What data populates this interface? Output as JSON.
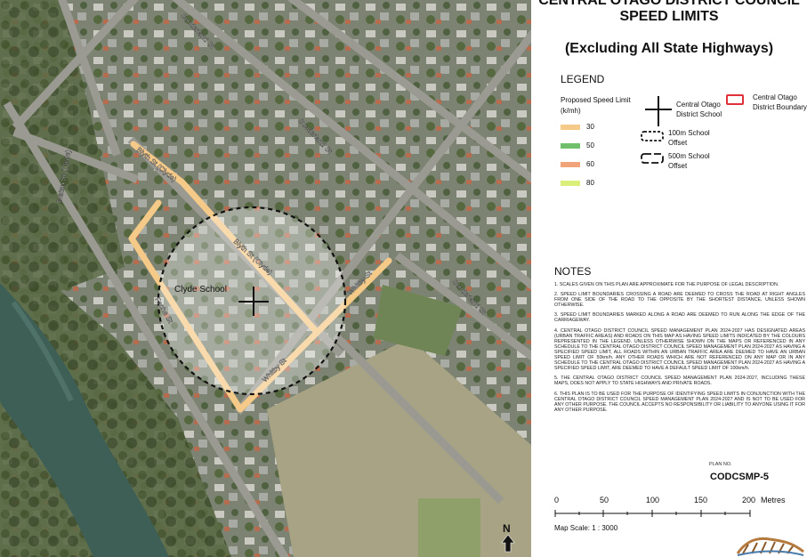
{
  "title_line1": "CENTRAL OTAGO DISTRICT COUNCIL",
  "title_line2": "SPEED LIMITS",
  "subtitle": "(Excluding All State Highways)",
  "legend": {
    "heading": "LEGEND",
    "speed_heading_1": "Proposed Speed Limit",
    "speed_heading_2": "(k/mh)",
    "speeds": [
      {
        "label": "30",
        "color": "#f5c987"
      },
      {
        "label": "50",
        "color": "#6fbf6b"
      },
      {
        "label": "60",
        "color": "#f1a47a"
      },
      {
        "label": "80",
        "color": "#d9ef7a"
      }
    ],
    "school_1": "Central Otago",
    "school_2": "District School",
    "offset100_1": "100m School",
    "offset100_2": "Offset",
    "offset500_1": "500m School",
    "offset500_2": "Offset",
    "boundary_1": "Central Otago",
    "boundary_2": "District Boundary",
    "boundary_color": "#e0303a"
  },
  "notes_heading": "NOTES",
  "notes": [
    "1. SCALES GIVEN ON THIS PLAN ARE APPROXIMATE FOR THE PURPOSE OF LEGAL DESCRIPTION.",
    "2. SPEED LIMIT BOUNDARIES CROSSING A ROAD ARE DEEMED TO CROSS THE ROAD AT RIGHT ANGLES FROM ONE SIDE OF THE ROAD TO THE OPPOSITE BY THE SHORTEST DISTANCE, UNLESS SHOWN OTHERWISE.",
    "3. SPEED LIMIT BOUNDARIES MARKED ALONG A ROAD ARE DEEMED TO RUN ALONG THE EDGE OF THE CARRIAGEWAY.",
    "4. CENTRAL OTAGO DISTRICT COUNCIL SPEED MANAGEMENT PLAN 2024-2027 HAS DESIGNATED AREAS (URBAN TRAFFIC AREAS) AND ROADS ON THIS MAP AS HAVING SPEED LIMITS INDICATED BY THE COLOURS REPRESENTED IN THE LEGEND. UNLESS OTHERWISE SHOWN ON THE MAPS OR REFERENCED IN ANY SCHEDULE TO THE CENTRAL OTAGO DISTRICT COUNCIL SPEED MANAGEMENT PLAN 2024-2027 AS HAVING A SPECIFIED SPEED LIMIT, ALL ROADS WITHIN AN URBAN TRAFFIC AREA ARE DEEMED TO HAVE AN URBAN SPEED LIMIT OF 50km/h. ANY OTHER ROADS WHICH ARE NOT REFERENCED ON ANY MAP OR IN ANY SCHEDULE TO THE CENTRAL OTAGO DISTRICT COUNCIL SPEED MANAGEMENT PLAN 2024-2027 AS HAVING A SPECIFIED SPEED LIMIT, ARE DEEMED TO HAVE A DEFAULT SPEED LIMIT OF 100km/h.",
    "5. THE CENTRAL OTAGO DISTRICT COUNCIL SPEED MANAGEMENT PLAN 2024-2027, INCLUDING THESE MAPS, DOES NOT APPLY TO STATE HIGHWAYS AND PRIVATE ROADS.",
    "6. THIS PLAN IS TO BE USED FOR THE PURPOSE OF IDENTIFYING SPEED LIMITS IN CONJUNCTION WITH THE CENTRAL OTAGO DISTRICT COUNCIL SPEED MANAGEMENT PLAN 2024-2027 AND IS NOT TO BE USED FOR ANY OTHER PURPOSE. THE COUNCIL ACCEPTS NO RESPONSIBILITY OR LIABILITY TO ANYONE USING IT FOR ANY OTHER PURPOSE."
  ],
  "plan_no_label": "PLAN NO.",
  "plan_no": "CODCSMP-5",
  "scale_bar": {
    "ticks": [
      "0",
      "50",
      "100",
      "150",
      "200"
    ],
    "unit": "Metres"
  },
  "map_scale": "Map Scale: 1 : 3000",
  "north": "N",
  "map_labels": {
    "sunderland_1": "Sunderland St",
    "sunderland_2": "Sunderland St",
    "sunderland_3": "Sunderland St",
    "matau": "Matau St (Clyde)",
    "blyth_1": "Blyth St (Clyde)",
    "blyth_2": "Blyth St (Clyde)",
    "fache": "Fache St",
    "whitby_1": "Whitby St",
    "whitby_2": "Whitby St",
    "school": "Clyde School"
  }
}
